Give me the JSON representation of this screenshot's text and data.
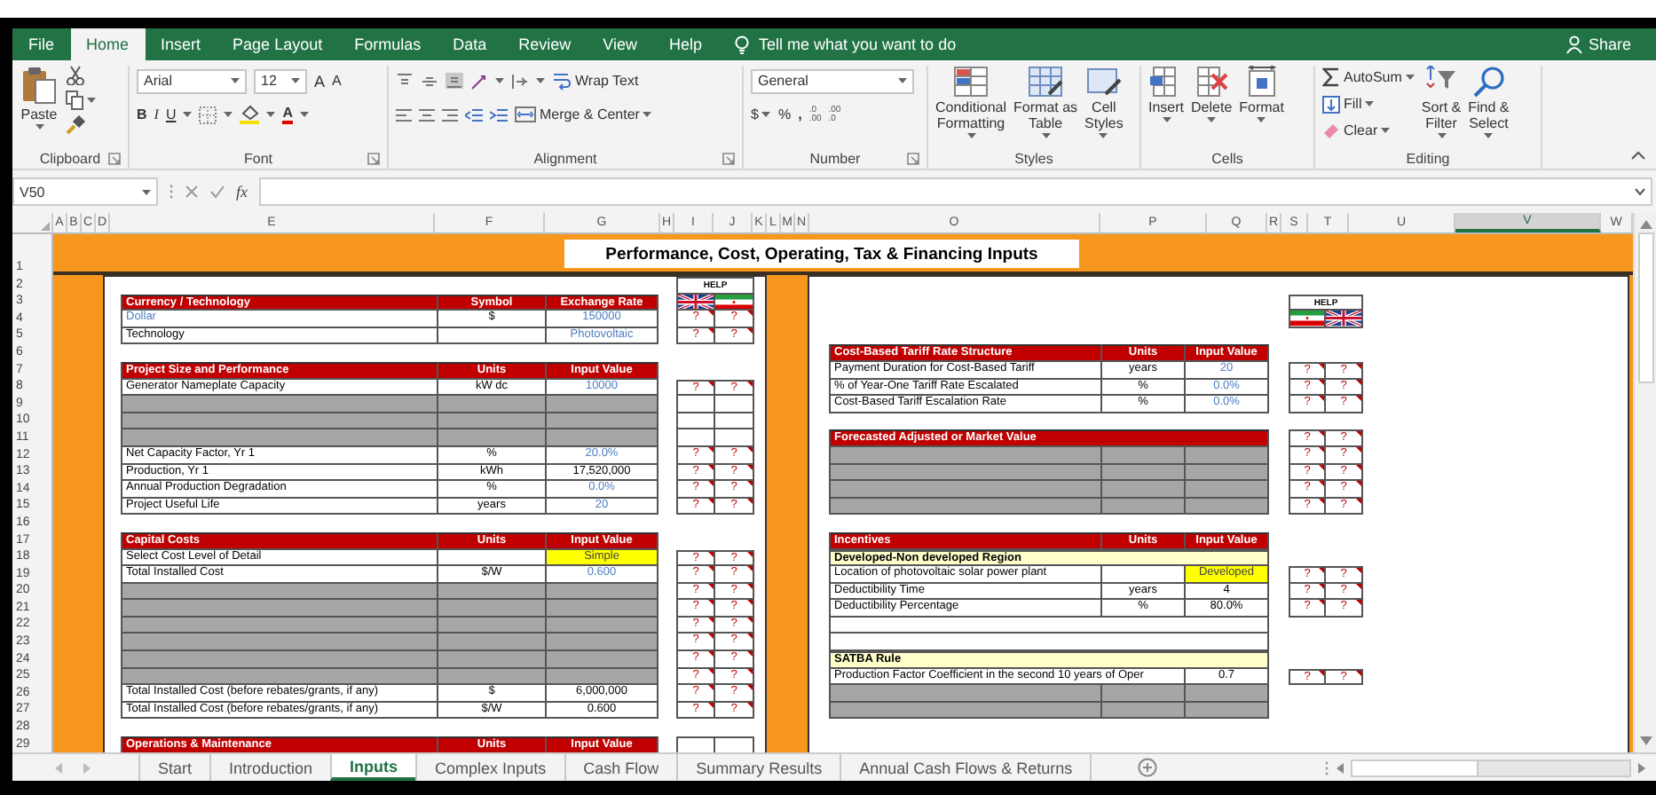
{
  "ribbon_tabs": [
    {
      "label": "File",
      "selected": false
    },
    {
      "label": "Home",
      "selected": true
    },
    {
      "label": "Insert",
      "selected": false
    },
    {
      "label": "Page Layout",
      "selected": false
    },
    {
      "label": "Formulas",
      "selected": false
    },
    {
      "label": "Data",
      "selected": false
    },
    {
      "label": "Review",
      "selected": false
    },
    {
      "label": "View",
      "selected": false
    },
    {
      "label": "Help",
      "selected": false
    }
  ],
  "tell_me": "Tell me what you want to do",
  "share": "Share",
  "ribbon_groups": [
    {
      "kind": "clipboard",
      "label": "Clipboard",
      "launcher": true,
      "paste": "Paste"
    },
    {
      "kind": "font",
      "label": "Font",
      "launcher": true,
      "font_name": "Arial",
      "font_size": "12",
      "grow": "A",
      "shrink": "A",
      "styles": [
        "B",
        "I",
        "U"
      ],
      "font_color": "A"
    },
    {
      "kind": "alignment",
      "label": "Alignment",
      "launcher": true,
      "wrap_text": "Wrap Text",
      "merge": "Merge & Center"
    },
    {
      "kind": "number",
      "label": "Number",
      "launcher": true,
      "format": "General",
      "currency": "$",
      "percent": "%",
      "comma": ",",
      "decimals": [
        [
          ".0",
          ".00"
        ],
        [
          ".00",
          ".0"
        ]
      ]
    },
    {
      "kind": "styles",
      "label": "Styles",
      "launcher": false,
      "buttons": [
        [
          "Conditional",
          "Formatting"
        ],
        [
          "Format as",
          "Table"
        ],
        [
          "Cell",
          "Styles"
        ]
      ]
    },
    {
      "kind": "cells",
      "label": "Cells",
      "launcher": false,
      "buttons": [
        "Insert",
        "Delete",
        "Format"
      ]
    },
    {
      "kind": "editing",
      "label": "Editing",
      "launcher": false,
      "autosum": "AutoSum",
      "fill": "Fill",
      "clear": "Clear",
      "buttons": [
        [
          "Sort &",
          "Filter"
        ],
        [
          "Find &",
          "Select"
        ]
      ]
    }
  ],
  "formula_bar": {
    "name_box": "V50",
    "function_label": "fx"
  },
  "sheet": {
    "title": "Performance, Cost, Operating, Tax & Financing Inputs",
    "columns": [
      {
        "label": "A",
        "selected": false
      },
      {
        "label": "B",
        "selected": false
      },
      {
        "label": "C",
        "selected": false
      },
      {
        "label": "D",
        "selected": false
      },
      {
        "label": "E",
        "selected": false
      },
      {
        "label": "F",
        "selected": false
      },
      {
        "label": "G",
        "selected": false
      },
      {
        "label": "H",
        "selected": false
      },
      {
        "label": "I",
        "selected": false
      },
      {
        "label": "J",
        "selected": false
      },
      {
        "label": "K",
        "selected": false
      },
      {
        "label": "L",
        "selected": false
      },
      {
        "label": "M",
        "selected": false
      },
      {
        "label": "N",
        "selected": false
      },
      {
        "label": "O",
        "selected": false
      },
      {
        "label": "P",
        "selected": false
      },
      {
        "label": "Q",
        "selected": false
      },
      {
        "label": "R",
        "selected": false
      },
      {
        "label": "S",
        "selected": false
      },
      {
        "label": "T",
        "selected": false
      },
      {
        "label": "U",
        "selected": false
      },
      {
        "label": "V",
        "selected": true
      },
      {
        "label": "W",
        "selected": false
      }
    ],
    "row_numbers": [
      "1",
      "2",
      "3",
      "4",
      "5",
      "6",
      "7",
      "8",
      "9",
      "10",
      "11",
      "12",
      "13",
      "14",
      "15",
      "16",
      "17",
      "18",
      "19",
      "20",
      "21",
      "22",
      "23",
      "24",
      "25",
      "26",
      "27",
      "28",
      "29"
    ],
    "left_panel": {
      "rows": [
        {
          "kind": "blank",
          "help": {
            "kind": "title",
            "text": "HELP"
          }
        },
        {
          "kind": "header",
          "label": "Currency / Technology",
          "units": "Symbol",
          "value": "Exchange Rate",
          "help": {
            "kind": "flags",
            "flags": [
              {
                "kind": "uk"
              },
              {
                "kind": "iran"
              }
            ]
          }
        },
        {
          "kind": "data",
          "label": "Dollar",
          "label_input": true,
          "units": "$",
          "value": "150000",
          "value_input": true,
          "value_highlighted": false,
          "help": {
            "kind": "q",
            "marks": [
              "?",
              "?"
            ]
          }
        },
        {
          "kind": "data",
          "label": "Technology",
          "label_input": false,
          "value": "Photovoltaic",
          "value_input": true,
          "value_highlighted": false,
          "help": {
            "kind": "q",
            "marks": [
              "?",
              "?"
            ]
          }
        },
        {
          "kind": "blank"
        },
        {
          "kind": "header",
          "label": "Project Size and Performance",
          "units": "Units",
          "value": "Input Value"
        },
        {
          "kind": "data",
          "label": "Generator Nameplate Capacity",
          "label_input": false,
          "units": "kW dc",
          "value": "10000",
          "value_input": true,
          "value_highlighted": false,
          "help": {
            "kind": "q",
            "marks": [
              "?",
              "?"
            ]
          }
        },
        {
          "kind": "gray",
          "help": {
            "kind": "frame"
          }
        },
        {
          "kind": "gray",
          "help": {
            "kind": "frame"
          }
        },
        {
          "kind": "gray",
          "help": {
            "kind": "frame"
          }
        },
        {
          "kind": "data",
          "label": "Net Capacity Factor, Yr 1",
          "label_input": false,
          "units": "%",
          "value": "20.0%",
          "value_input": true,
          "value_highlighted": false,
          "help": {
            "kind": "q",
            "marks": [
              "?",
              "?"
            ]
          }
        },
        {
          "kind": "data",
          "label": "Production, Yr 1",
          "label_input": false,
          "units": "kWh",
          "value": "17,520,000",
          "value_input": false,
          "value_highlighted": false,
          "help": {
            "kind": "q",
            "marks": [
              "?",
              "?"
            ]
          }
        },
        {
          "kind": "data",
          "label": "Annual Production Degradation",
          "label_input": false,
          "units": "%",
          "value": "0.0%",
          "value_input": true,
          "value_highlighted": false,
          "help": {
            "kind": "q",
            "marks": [
              "?",
              "?"
            ]
          }
        },
        {
          "kind": "data",
          "label": "Project Useful Life",
          "label_input": false,
          "units": "years",
          "value": "20",
          "value_input": true,
          "value_highlighted": false,
          "help": {
            "kind": "q",
            "marks": [
              "?",
              "?"
            ]
          }
        },
        {
          "kind": "blank"
        },
        {
          "kind": "header",
          "label": "Capital Costs",
          "units": "Units",
          "value": "Input Value"
        },
        {
          "kind": "data",
          "label": "Select Cost Level of Detail",
          "label_input": false,
          "value": "Simple",
          "value_input": false,
          "value_highlighted": true,
          "help": {
            "kind": "q",
            "marks": [
              "?",
              "?"
            ]
          }
        },
        {
          "kind": "data",
          "label": "Total Installed Cost",
          "label_input": false,
          "units": "$/W",
          "value": "0.600",
          "value_input": true,
          "value_highlighted": false,
          "help": {
            "kind": "q",
            "marks": [
              "?",
              "?"
            ]
          }
        },
        {
          "kind": "gray",
          "help": {
            "kind": "q",
            "marks": [
              "?",
              "?"
            ]
          }
        },
        {
          "kind": "gray",
          "help": {
            "kind": "q",
            "marks": [
              "?",
              "?"
            ]
          }
        },
        {
          "kind": "gray",
          "help": {
            "kind": "q",
            "marks": [
              "?",
              "?"
            ]
          }
        },
        {
          "kind": "gray",
          "help": {
            "kind": "q",
            "marks": [
              "?",
              "?"
            ]
          }
        },
        {
          "kind": "gray",
          "help": {
            "kind": "q",
            "marks": [
              "?",
              "?"
            ]
          }
        },
        {
          "kind": "gray",
          "help": {
            "kind": "q",
            "marks": [
              "?",
              "?"
            ]
          }
        },
        {
          "kind": "data",
          "label": "Total Installed Cost (before rebates/grants, if any)",
          "label_input": false,
          "units": "$",
          "value": "6,000,000",
          "value_input": false,
          "value_highlighted": false,
          "help": {
            "kind": "q",
            "marks": [
              "?",
              "?"
            ]
          }
        },
        {
          "kind": "data",
          "label": "Total Installed Cost (before rebates/grants, if any)",
          "label_input": false,
          "units": "$/W",
          "value": "0.600",
          "value_input": false,
          "value_highlighted": false,
          "help": {
            "kind": "q",
            "marks": [
              "?",
              "?"
            ]
          }
        },
        {
          "kind": "blank"
        },
        {
          "kind": "header",
          "label": "Operations & Maintenance",
          "units": "Units",
          "value": "Input Value",
          "help": {
            "kind": "frame"
          }
        }
      ]
    },
    "right_panel": {
      "rows": [
        {
          "kind": "blank"
        },
        {
          "kind": "blank",
          "help": {
            "kind": "title",
            "text": "HELP"
          }
        },
        {
          "kind": "blank",
          "help": {
            "kind": "flags",
            "flags": [
              {
                "kind": "iran"
              },
              {
                "kind": "uk"
              }
            ]
          }
        },
        {
          "kind": "blank"
        },
        {
          "kind": "header",
          "label": "Cost-Based Tariff Rate Structure",
          "units": "Units",
          "value": "Input Value"
        },
        {
          "kind": "data",
          "label": "Payment Duration for Cost-Based Tariff",
          "label_input": false,
          "units": "years",
          "value": "20",
          "value_input": true,
          "value_highlighted": false,
          "help": {
            "kind": "q",
            "marks": [
              "?",
              "?"
            ]
          }
        },
        {
          "kind": "data",
          "label": "% of Year-One Tariff Rate Escalated",
          "label_input": false,
          "units": "%",
          "value": "0.0%",
          "value_input": true,
          "value_highlighted": false,
          "help": {
            "kind": "q",
            "marks": [
              "?",
              "?"
            ]
          }
        },
        {
          "kind": "data",
          "label": "Cost-Based Tariff Escalation Rate",
          "label_input": false,
          "units": "%",
          "value": "0.0%",
          "value_input": true,
          "value_highlighted": false,
          "help": {
            "kind": "q",
            "marks": [
              "?",
              "?"
            ]
          }
        },
        {
          "kind": "blank"
        },
        {
          "kind": "header",
          "label": "Forecasted Adjusted or Market Value",
          "help": {
            "kind": "q",
            "marks": [
              "?",
              "?"
            ]
          }
        },
        {
          "kind": "gray",
          "help": {
            "kind": "q",
            "marks": [
              "?",
              "?"
            ]
          }
        },
        {
          "kind": "gray",
          "help": {
            "kind": "q",
            "marks": [
              "?",
              "?"
            ]
          }
        },
        {
          "kind": "gray",
          "help": {
            "kind": "q",
            "marks": [
              "?",
              "?"
            ]
          }
        },
        {
          "kind": "gray",
          "help": {
            "kind": "q",
            "marks": [
              "?",
              "?"
            ]
          }
        },
        {
          "kind": "blank"
        },
        {
          "kind": "header",
          "label": "Incentives",
          "units": "Units",
          "value": "Input Value"
        },
        {
          "kind": "section",
          "label": "Developed-Non developed Region"
        },
        {
          "kind": "data",
          "label": "Location of photovoltaic solar power plant",
          "label_input": false,
          "value": "Developed",
          "value_input": false,
          "value_highlighted": true,
          "help": {
            "kind": "q",
            "marks": [
              "?",
              "?"
            ]
          }
        },
        {
          "kind": "data",
          "label": "Deductibility Time",
          "label_input": false,
          "units": "years",
          "value": "4",
          "value_input": false,
          "value_highlighted": false,
          "help": {
            "kind": "q",
            "marks": [
              "?",
              "?"
            ]
          }
        },
        {
          "kind": "data",
          "label": "Deductibility Percentage",
          "label_input": false,
          "units": "%",
          "value": "80.0%",
          "value_input": false,
          "value_highlighted": false,
          "help": {
            "kind": "q",
            "marks": [
              "?",
              "?"
            ]
          }
        },
        {
          "kind": "empty"
        },
        {
          "kind": "empty"
        },
        {
          "kind": "section",
          "label": "SATBA Rule"
        },
        {
          "kind": "wide",
          "label": "Production Factor Coefficient in the second 10 years of Oper",
          "label_input": false,
          "value": "0.7",
          "value_input": false,
          "value_highlighted": false,
          "help": {
            "kind": "q",
            "marks": [
              "?",
              "?"
            ]
          }
        },
        {
          "kind": "gray"
        },
        {
          "kind": "gray"
        },
        {
          "kind": "blank"
        },
        {
          "kind": "blank"
        }
      ]
    }
  },
  "sheet_tabs": [
    {
      "label": "Start",
      "selected": false
    },
    {
      "label": "Introduction",
      "selected": false
    },
    {
      "label": "Inputs",
      "selected": true
    },
    {
      "label": "Complex Inputs",
      "selected": false
    },
    {
      "label": "Cash Flow",
      "selected": false
    },
    {
      "label": "Summary Results",
      "selected": false
    },
    {
      "label": "Annual Cash Flows & Returns",
      "selected": false
    }
  ]
}
